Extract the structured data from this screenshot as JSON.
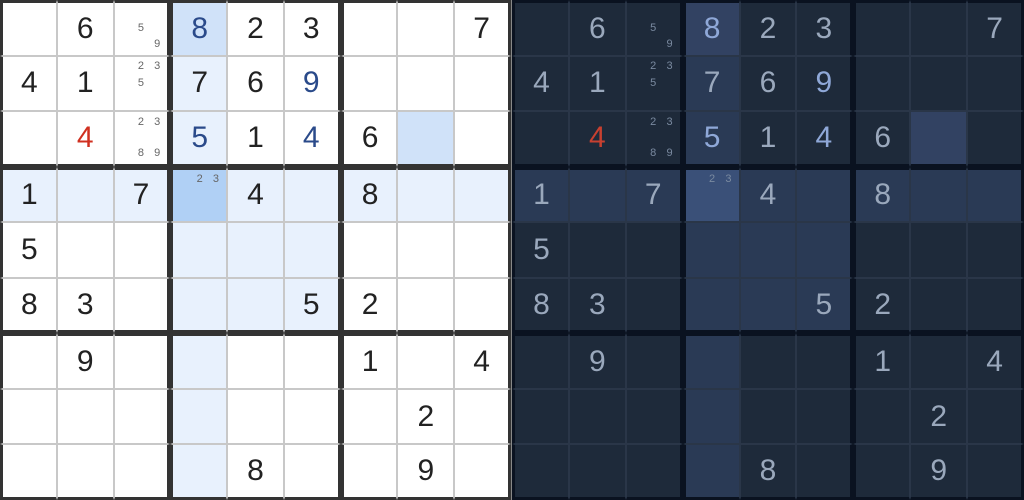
{
  "themes": [
    "light",
    "dark"
  ],
  "selected": {
    "row": 3,
    "col": 3
  },
  "highlight": {
    "row": 3,
    "col": 3,
    "box": {
      "row": 1,
      "col": 1
    },
    "sameValueCells": [
      [
        0,
        3
      ],
      [
        2,
        7
      ]
    ]
  },
  "grid": [
    [
      {
        "v": null
      },
      {
        "v": "6"
      },
      {
        "pencil": [
          "5",
          "9"
        ]
      },
      {
        "v": "8",
        "user": true
      },
      {
        "v": "2"
      },
      {
        "v": "3"
      },
      {
        "v": null
      },
      {
        "v": null
      },
      {
        "v": "7"
      }
    ],
    [
      {
        "v": "4"
      },
      {
        "v": "1"
      },
      {
        "pencil": [
          "2",
          "3",
          "5"
        ]
      },
      {
        "v": "7"
      },
      {
        "v": "6"
      },
      {
        "v": "9",
        "user": true
      },
      {
        "v": null
      },
      {
        "v": null
      },
      {
        "v": null
      }
    ],
    [
      {
        "v": null
      },
      {
        "v": "4",
        "error": true
      },
      {
        "pencil": [
          "2",
          "3",
          "8",
          "9"
        ]
      },
      {
        "v": "5",
        "user": true
      },
      {
        "v": "1"
      },
      {
        "v": "4",
        "user": true
      },
      {
        "v": "6"
      },
      {
        "v": null
      },
      {
        "v": null
      }
    ],
    [
      {
        "v": "1"
      },
      {
        "v": null
      },
      {
        "v": "7"
      },
      {
        "pencil": [
          "2",
          "3"
        ]
      },
      {
        "v": "4"
      },
      {
        "v": null
      },
      {
        "v": "8"
      },
      {
        "v": null
      },
      {
        "v": null
      }
    ],
    [
      {
        "v": "5"
      },
      {
        "v": null
      },
      {
        "v": null
      },
      {
        "v": null
      },
      {
        "v": null
      },
      {
        "v": null
      },
      {
        "v": null
      },
      {
        "v": null
      },
      {
        "v": null
      }
    ],
    [
      {
        "v": "8"
      },
      {
        "v": "3"
      },
      {
        "v": null
      },
      {
        "v": null
      },
      {
        "v": null
      },
      {
        "v": "5"
      },
      {
        "v": "2"
      },
      {
        "v": null
      },
      {
        "v": null
      }
    ],
    [
      {
        "v": null
      },
      {
        "v": "9"
      },
      {
        "v": null
      },
      {
        "v": null
      },
      {
        "v": null
      },
      {
        "v": null
      },
      {
        "v": "1"
      },
      {
        "v": null
      },
      {
        "v": "4"
      }
    ],
    [
      {
        "v": null
      },
      {
        "v": null
      },
      {
        "v": null
      },
      {
        "v": null
      },
      {
        "v": null
      },
      {
        "v": null
      },
      {
        "v": null
      },
      {
        "v": "2"
      },
      {
        "v": null
      }
    ],
    [
      {
        "v": null
      },
      {
        "v": null
      },
      {
        "v": null
      },
      {
        "v": null
      },
      {
        "v": "8"
      },
      {
        "v": null
      },
      {
        "v": null
      },
      {
        "v": "9"
      },
      {
        "v": null
      }
    ]
  ]
}
